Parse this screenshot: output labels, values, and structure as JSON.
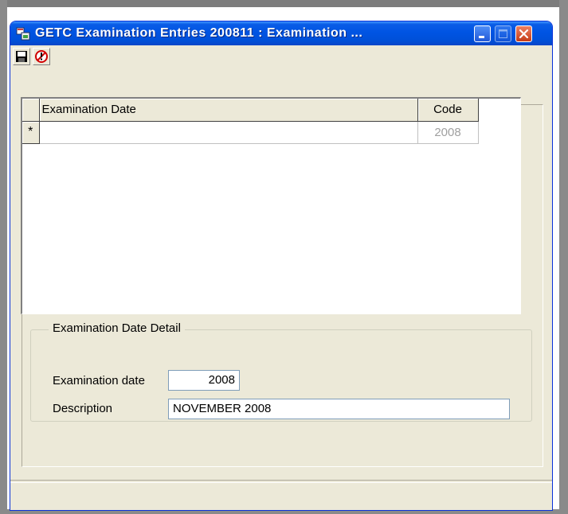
{
  "window": {
    "title": "GETC Examination Entries 200811 : Examination ...",
    "app_icon": "app-window-icon",
    "title_buttons": [
      "minimize-icon",
      "maximize-icon",
      "close-icon"
    ]
  },
  "toolbar": {
    "save_icon": "save-icon",
    "cancel_icon": "cancel-icon"
  },
  "grid": {
    "columns": [
      "Examination Date",
      "Code"
    ],
    "new_row": {
      "indicator": "*",
      "examination_date": "",
      "code": "2008"
    }
  },
  "detail": {
    "title": "Examination Date Detail",
    "exam_date_label": "Examination date",
    "exam_date_value": "2008",
    "description_label": "Description",
    "description_value": "NOVEMBER 2008"
  },
  "colors": {
    "titlebar": "#0054e3",
    "window_bg": "#ece9d8",
    "close_button": "#c53b17"
  }
}
